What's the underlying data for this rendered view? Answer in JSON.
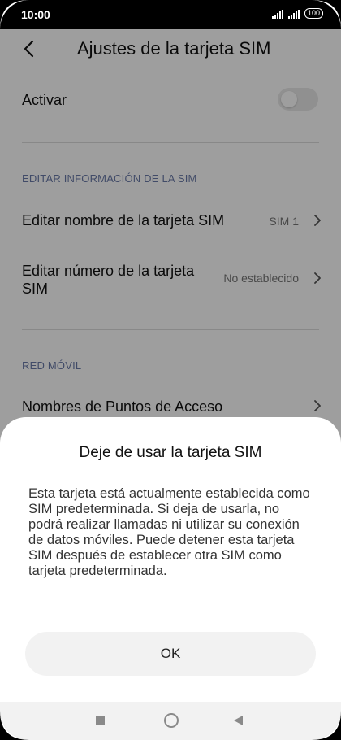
{
  "status_bar": {
    "time": "10:00",
    "battery": "100"
  },
  "header": {
    "title": "Ajustes de la tarjeta SIM",
    "back_icon": "chevron-left-icon"
  },
  "settings": {
    "activate": {
      "label": "Activar",
      "toggle_state": "off"
    },
    "section_edit": "EDITAR INFORMACIÓN DE LA SIM",
    "edit_name": {
      "label": "Editar nombre de la tarjeta SIM",
      "value": "SIM 1"
    },
    "edit_number": {
      "label": "Editar número de la tarjeta SIM",
      "value": "No establecido"
    },
    "section_network": "RED MÓVIL",
    "apn": {
      "label": "Nombres de Puntos de Acceso"
    }
  },
  "dialog": {
    "title": "Deje de usar la tarjeta SIM",
    "message": "Esta tarjeta está actualmente establecida como SIM predeterminada. Si deja de usarla, no podrá realizar llamadas ni utilizar su conexión de datos móviles. Puede detener esta tarjeta SIM después de establecer otra SIM como tarjeta predeterminada.",
    "ok_label": "OK"
  },
  "colors": {
    "section_header": "#6a7aa8",
    "overlay": "rgba(0,0,0,0.38)",
    "button_bg": "#f2f2f2"
  }
}
